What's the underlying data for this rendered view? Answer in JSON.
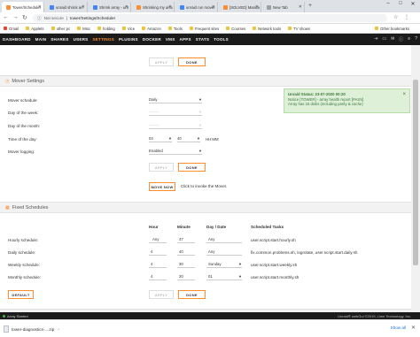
{
  "browser": {
    "tabs": [
      {
        "title": "Tower/Scheduler",
        "color": "#ff8c2f",
        "active": true
      },
      {
        "title": "unraid shrink arr",
        "color": "#4285f4",
        "active": false
      },
      {
        "title": "Shrink array - unr",
        "color": "#4285f4",
        "active": false
      },
      {
        "title": "Shrinking my arra",
        "color": "#ff8c2f",
        "active": false
      },
      {
        "title": "unraid run mover",
        "color": "#4285f4",
        "active": false
      },
      {
        "title": "[SOLVED] Manua",
        "color": "#ff8c2f",
        "active": false
      },
      {
        "title": "New Tab",
        "color": "#9aa0a6",
        "active": false
      }
    ],
    "not_secure": "Not secure",
    "url": "tower/Settings/Scheduler",
    "bookmarks": [
      "Gmail",
      "Applets",
      "other pc",
      "Misc",
      "holding",
      "Vice",
      "Amazon",
      "Tools",
      "Frequent sites",
      "Courses",
      "Network tools",
      "TV shows"
    ],
    "other_bookmarks": "Other bookmarks"
  },
  "nav": {
    "items": [
      "DASHBOARD",
      "MAIN",
      "SHARES",
      "USERS",
      "SETTINGS",
      "PLUGINS",
      "DOCKER",
      "VMS",
      "APPS",
      "STATS",
      "TOOLS"
    ],
    "active": "SETTINGS"
  },
  "buttons": {
    "apply": "APPLY",
    "done": "DONE",
    "move_now": "MOVE NOW",
    "default": "DEFAULT"
  },
  "mover": {
    "title": "Mover Settings",
    "schedule_label": "Mover schedule:",
    "schedule_value": "Daily",
    "dow_label": "Day of the week:",
    "dow_value": "--------",
    "dom_label": "Day of the month:",
    "dom_value": "--------",
    "time_label": "Time of the day:",
    "time_hh": "03",
    "time_mm": "40",
    "time_format": "HH:MM",
    "logging_label": "Mover logging:",
    "logging_value": "Enabled",
    "move_now_hint": "Click to invoke the Mover."
  },
  "fixed": {
    "title": "Fixed Schedules",
    "headers": {
      "hour": "Hour",
      "minute": "Minute",
      "day": "Day / Date",
      "tasks": "Scheduled Tasks"
    },
    "rows": [
      {
        "label": "Hourly schedule:",
        "hour": "Any",
        "minute": "47",
        "day": "Any",
        "task": "user.script.start.hourly.sh"
      },
      {
        "label": "Daily schedule:",
        "hour": "4",
        "minute": "40",
        "day": "Any",
        "task": "fix.common.problems.sh, logrotate, user.script.start.daily.sh"
      },
      {
        "label": "Weekly schedule:",
        "hour": "4",
        "minute": "30",
        "day": "Sunday",
        "task": "user.script.start.weekly.sh"
      },
      {
        "label": "Monthly schedule:",
        "hour": "4",
        "minute": "20",
        "day": "01",
        "task": "user.script.start.monthly.sh"
      }
    ]
  },
  "notice": {
    "title": "Unraid Status: 23-07-2020 00:20",
    "line1": "Notice [TOWER] - array health report [PASS]",
    "line2": "Array has 15 disks (including parity & cache)"
  },
  "statusbar": {
    "left": "Array Started",
    "right": "Unraid® webGui ©2019, Lime Technology, Inc."
  },
  "download": {
    "filename": "tower-diagnostics-....zip",
    "show_all": "Show all"
  }
}
